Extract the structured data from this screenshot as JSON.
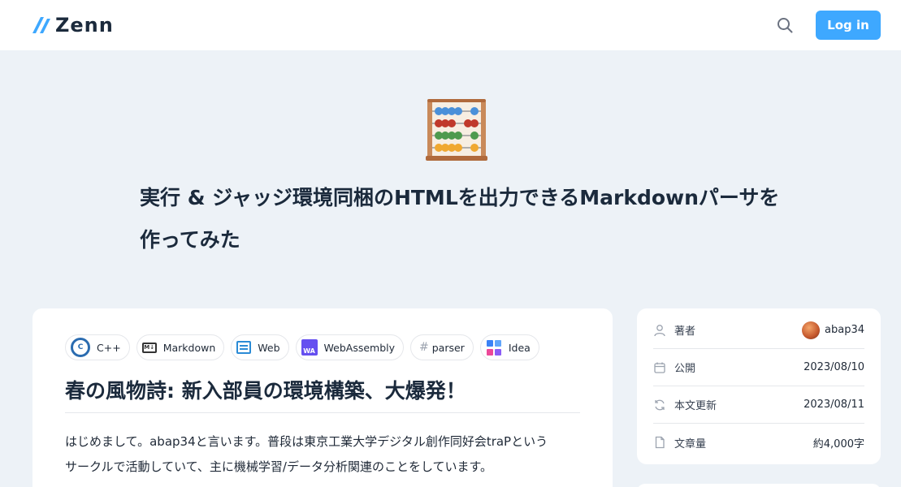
{
  "header": {
    "logo_text": "Zenn",
    "login_label": "Log in",
    "accent": "#3ea8ff"
  },
  "article": {
    "emoji": "abacus-icon",
    "title": "実行 & ジャッジ環境同梱のHTMLを出力できるMarkdownパーサを作ってみた",
    "topics": [
      {
        "label": "C++",
        "icon": "cpp-icon"
      },
      {
        "label": "Markdown",
        "icon": "markdown-icon"
      },
      {
        "label": "Web",
        "icon": "web-icon"
      },
      {
        "label": "WebAssembly",
        "icon": "webassembly-icon"
      },
      {
        "label": "parser",
        "icon": "hash-icon"
      },
      {
        "label": "Idea",
        "icon": "idea-icon"
      }
    ],
    "heading": "春の風物詩: 新入部員の環境構築、大爆発！",
    "paragraph_line1": "はじめまして。abap34と言います。普段は東京工業大学デジタル創作同好会traPという",
    "paragraph_line2": "サークルで活動していて、主に機械学習/データ分析関連のことをしています。"
  },
  "meta": {
    "author_label": "著者",
    "author_name": "abap34",
    "published_label": "公開",
    "published_date": "2023/08/10",
    "updated_label": "本文更新",
    "updated_date": "2023/08/11",
    "length_label": "文章量",
    "length_value": "約4,000字"
  }
}
